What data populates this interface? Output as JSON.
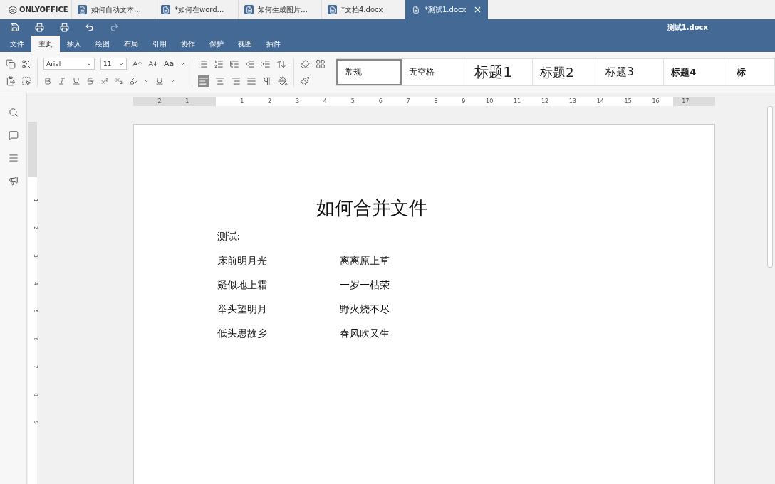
{
  "app": {
    "brand": "ONLYOFFICE"
  },
  "tabs": [
    {
      "label": "如何自动文本…",
      "selected": false
    },
    {
      "label": "*如何在word…",
      "selected": false
    },
    {
      "label": "如何生成图片…",
      "selected": false
    },
    {
      "label": "*文档4.docx",
      "selected": false
    },
    {
      "label": "*测试1.docx",
      "selected": true
    }
  ],
  "window": {
    "title": "测试1.docx"
  },
  "menu": [
    {
      "label": "文件",
      "selected": false
    },
    {
      "label": "主页",
      "selected": true
    },
    {
      "label": "插入",
      "selected": false
    },
    {
      "label": "绘图",
      "selected": false
    },
    {
      "label": "布局",
      "selected": false
    },
    {
      "label": "引用",
      "selected": false
    },
    {
      "label": "协作",
      "selected": false
    },
    {
      "label": "保护",
      "selected": false
    },
    {
      "label": "视图",
      "selected": false
    },
    {
      "label": "插件",
      "selected": false
    }
  ],
  "toolbar": {
    "font": "Arial",
    "size": "11",
    "case_label": "Aa"
  },
  "styles": [
    {
      "label": "常规",
      "selected": true,
      "kind": "normal"
    },
    {
      "label": "无空格",
      "selected": false,
      "kind": "normal"
    },
    {
      "label": "标题1",
      "selected": false,
      "kind": "h1"
    },
    {
      "label": "标题2",
      "selected": false,
      "kind": "h2"
    },
    {
      "label": "标题3",
      "selected": false,
      "kind": "h3"
    },
    {
      "label": "标题4",
      "selected": false,
      "kind": "h4"
    },
    {
      "label": "标",
      "selected": false,
      "kind": "h4"
    }
  ],
  "ruler": {
    "before": [
      "2",
      "1"
    ],
    "after": [
      "1",
      "2",
      "3",
      "4",
      "5",
      "6",
      "7",
      "8",
      "9",
      "10",
      "11",
      "12",
      "13",
      "14",
      "15",
      "16",
      "17"
    ],
    "vertical": [
      "1",
      "2",
      "3",
      "4",
      "5",
      "6",
      "7",
      "8",
      "9"
    ]
  },
  "document": {
    "title": "如何合并文件",
    "intro": "测试:",
    "rows": [
      [
        "床前明月光",
        "离离原上草"
      ],
      [
        "疑似地上霜",
        "一岁一枯荣"
      ],
      [
        "举头望明月",
        "野火烧不尽"
      ],
      [
        "低头思故乡",
        "春风吹又生"
      ]
    ]
  }
}
